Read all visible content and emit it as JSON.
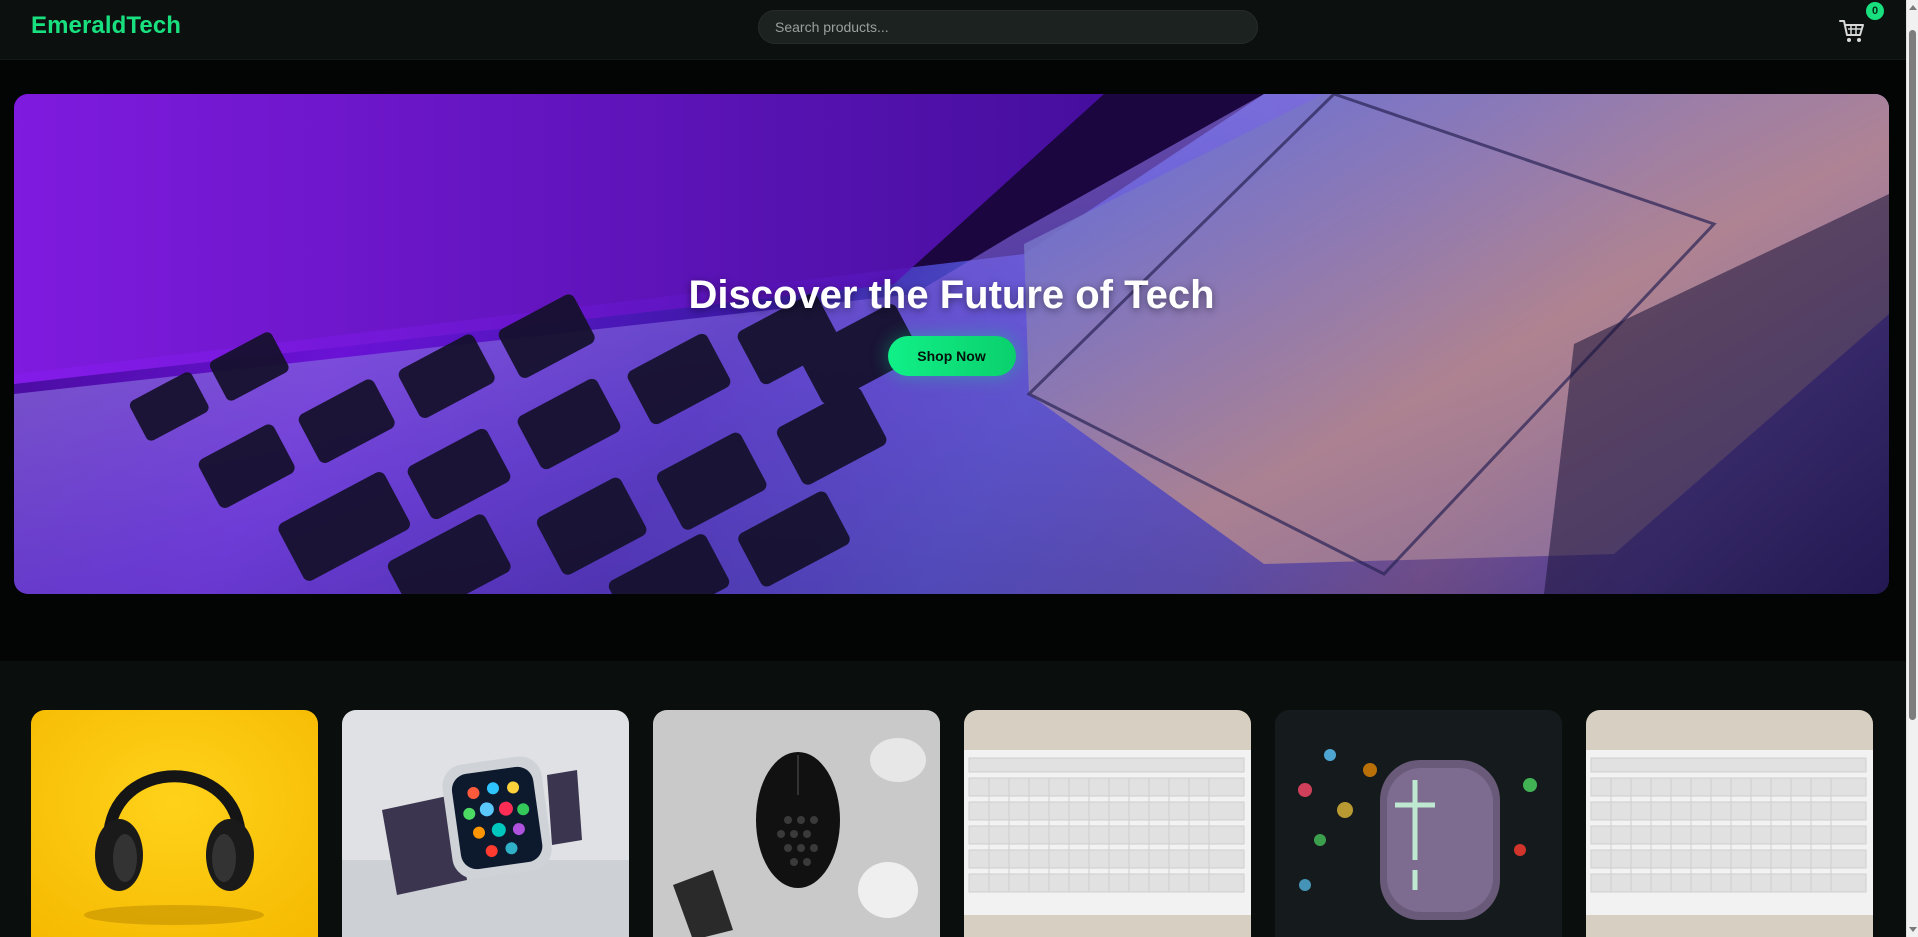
{
  "header": {
    "logo": "EmeraldTech",
    "search_placeholder": "Search products...",
    "cart_count": "0",
    "cart_icon": "cart-icon"
  },
  "hero": {
    "title": "Discover the Future of Tech",
    "cta_label": "Shop Now",
    "image": "laptop-keyboard-photo"
  },
  "products": [
    {
      "image": "headphones-photo"
    },
    {
      "image": "smartwatch-photo"
    },
    {
      "image": "gaming-mouse-photo"
    },
    {
      "image": "keyboard-photo"
    },
    {
      "image": "bluetooth-speaker-photo"
    },
    {
      "image": "keyboard-photo"
    }
  ],
  "colors": {
    "accent": "#19e07f",
    "header_bg": "#0c1110",
    "page_bg": "#050807"
  }
}
